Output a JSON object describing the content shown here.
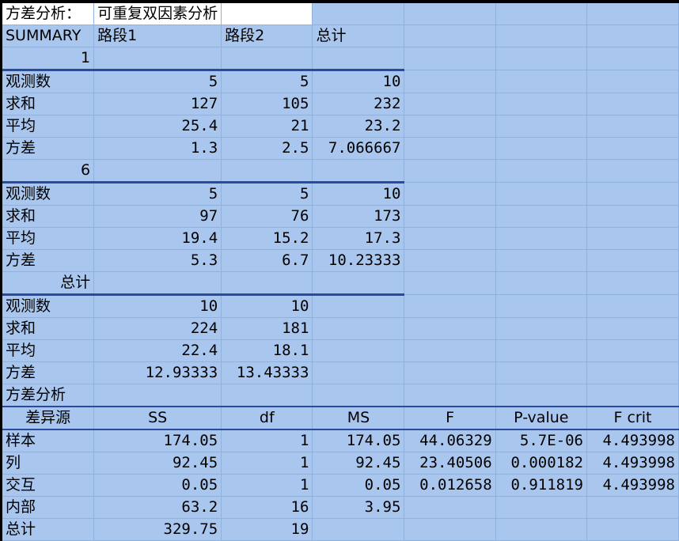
{
  "title_row": {
    "title": "方差分析：",
    "subtitle": "可重复双因素分析"
  },
  "summary_header": {
    "label": "SUMMARY",
    "col1": "路段1",
    "col2": "路段2",
    "col3": "总计"
  },
  "groups": [
    {
      "name": "1",
      "rows": [
        {
          "label": "观测数",
          "v1": "5",
          "v2": "5",
          "v3": "10"
        },
        {
          "label": "求和",
          "v1": "127",
          "v2": "105",
          "v3": "232"
        },
        {
          "label": "平均",
          "v1": "25.4",
          "v2": "21",
          "v3": "23.2"
        },
        {
          "label": "方差",
          "v1": "1.3",
          "v2": "2.5",
          "v3": "7.066667"
        }
      ]
    },
    {
      "name": "6",
      "rows": [
        {
          "label": "观测数",
          "v1": "5",
          "v2": "5",
          "v3": "10"
        },
        {
          "label": "求和",
          "v1": "97",
          "v2": "76",
          "v3": "173"
        },
        {
          "label": "平均",
          "v1": "19.4",
          "v2": "15.2",
          "v3": "17.3"
        },
        {
          "label": "方差",
          "v1": "5.3",
          "v2": "6.7",
          "v3": "10.23333"
        }
      ]
    },
    {
      "name": "总计",
      "rows": [
        {
          "label": "观测数",
          "v1": "10",
          "v2": "10",
          "v3": ""
        },
        {
          "label": "求和",
          "v1": "224",
          "v2": "181",
          "v3": ""
        },
        {
          "label": "平均",
          "v1": "22.4",
          "v2": "18.1",
          "v3": ""
        },
        {
          "label": "方差",
          "v1": "12.93333",
          "v2": "13.43333",
          "v3": ""
        }
      ]
    }
  ],
  "anova": {
    "title": "方差分析",
    "headers": [
      "差异源",
      "SS",
      "df",
      "MS",
      "F",
      "P-value",
      "F crit"
    ],
    "rows": [
      [
        "样本",
        "174.05",
        "1",
        "174.05",
        "44.06329",
        "5.7E-06",
        "4.493998"
      ],
      [
        "列",
        "92.45",
        "1",
        "92.45",
        "23.40506",
        "0.000182",
        "4.493998"
      ],
      [
        "交互",
        "0.05",
        "1",
        "0.05",
        "0.012658",
        "0.911819",
        "4.493998"
      ],
      [
        "内部",
        "63.2",
        "16",
        "3.95",
        "",
        "",
        ""
      ],
      [
        "总计",
        "329.75",
        "19",
        "",
        "",
        "",
        ""
      ]
    ]
  },
  "colors": {
    "cell_bg": "#a9c7ee",
    "gridline": "#8fb1dc",
    "section_rule": "#2a4aa0",
    "highlight": "#ffffff"
  }
}
